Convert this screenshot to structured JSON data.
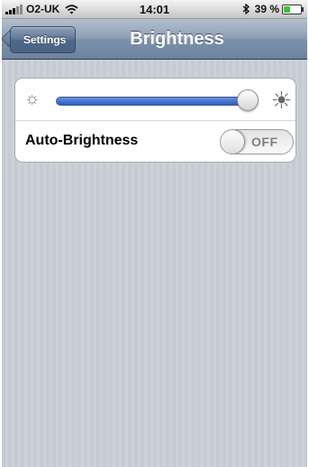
{
  "status_bar": {
    "carrier": "O2-UK",
    "time": "14:01",
    "battery_text": "39 %",
    "battery_level": 0.39,
    "battery_color": "#3fc13a",
    "icons": [
      "signal-icon",
      "wifi-icon",
      "bluetooth-icon",
      "battery-icon"
    ]
  },
  "nav": {
    "back_label": "Settings",
    "title": "Brightness"
  },
  "brightness": {
    "level": 0.95,
    "min_icon": "sun-small-icon",
    "max_icon": "sun-large-icon",
    "track_color": "#2a5bc9"
  },
  "auto_brightness": {
    "label": "Auto-Brightness",
    "state": "OFF"
  }
}
